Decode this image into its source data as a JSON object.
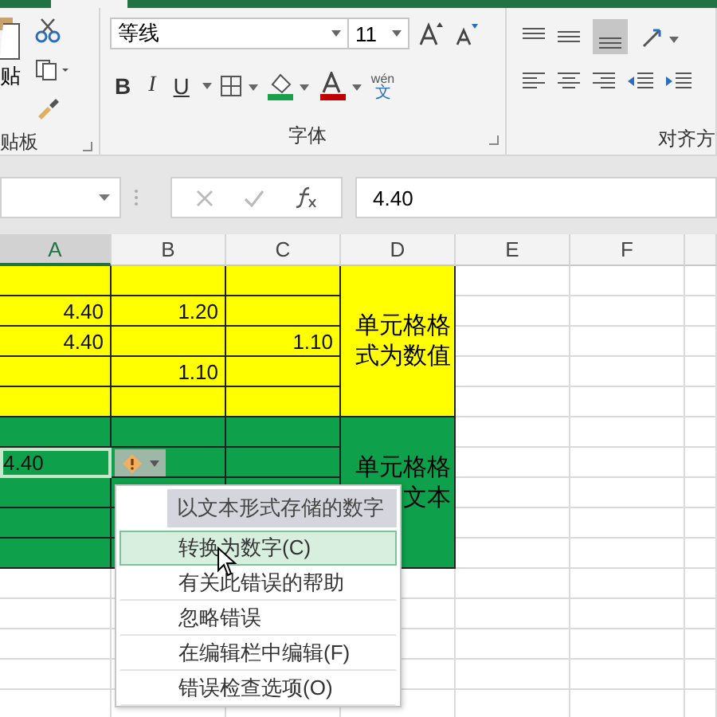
{
  "ribbon": {
    "clipboard": {
      "paste_label": "贴",
      "group_label": "贴板"
    },
    "font": {
      "font_name": "等线",
      "font_size": "11",
      "format_buttons": [
        {
          "label": "B",
          "kind": "bold"
        },
        {
          "label": "I",
          "kind": "italic"
        },
        {
          "label": "U",
          "kind": "underline"
        }
      ],
      "phonetic_label": "wén",
      "phonetic_char": "文",
      "group_label": "字体"
    },
    "alignment": {
      "group_label": "对齐方"
    }
  },
  "formula_bar": {
    "value": "4.40"
  },
  "columns": [
    {
      "label": "A",
      "selected": true
    },
    {
      "label": "B",
      "selected": false
    },
    {
      "label": "C",
      "selected": false
    },
    {
      "label": "D",
      "selected": false
    },
    {
      "label": "E",
      "selected": false
    },
    {
      "label": "F",
      "selected": false
    }
  ],
  "error_indicator": {
    "shown": true
  },
  "rows": [
    {
      "color": "#ffff00",
      "cells": [
        "",
        "",
        ""
      ],
      "active": false
    },
    {
      "color": "#ffff00",
      "cells": [
        "4.40",
        "1.20",
        ""
      ],
      "active": false
    },
    {
      "color": "#ffff00",
      "cells": [
        "4.40",
        "",
        "1.10"
      ],
      "active": false
    },
    {
      "color": "#ffff00",
      "cells": [
        "",
        "1.10",
        ""
      ],
      "active": false
    },
    {
      "color": "#ffff00",
      "cells": [
        "",
        "",
        ""
      ],
      "active": false
    },
    {
      "color": "#0ea04b",
      "cells": [
        "",
        "",
        ""
      ],
      "active": false
    },
    {
      "color": "#0ea04b",
      "cells": [
        "4.40",
        "",
        ""
      ],
      "active": true
    },
    {
      "color": "#0ea04b",
      "cells": [
        "",
        "",
        ""
      ],
      "active": false
    },
    {
      "color": "#0ea04b",
      "cells": [
        "",
        "",
        ""
      ],
      "active": false
    },
    {
      "color": "#0ea04b",
      "cells": [
        "",
        "",
        ""
      ],
      "active": false
    }
  ],
  "merged_notes": [
    {
      "color": "#ffff00",
      "lines": [
        "单元格格",
        "式为数值"
      ]
    },
    {
      "color": "#0ea04b",
      "lines": [
        "单元格格",
        "文本"
      ]
    }
  ],
  "error_menu": {
    "title": "以文本形式存储的数字",
    "items": [
      {
        "label": "转换为数字(C)",
        "selected": true
      },
      {
        "label": "有关此错误的帮助",
        "selected": false
      },
      {
        "label": "忽略错误",
        "selected": false
      },
      {
        "label": "在编辑栏中编辑(F)",
        "selected": false
      },
      {
        "label": "错误检查选项(O)",
        "selected": false
      }
    ]
  }
}
